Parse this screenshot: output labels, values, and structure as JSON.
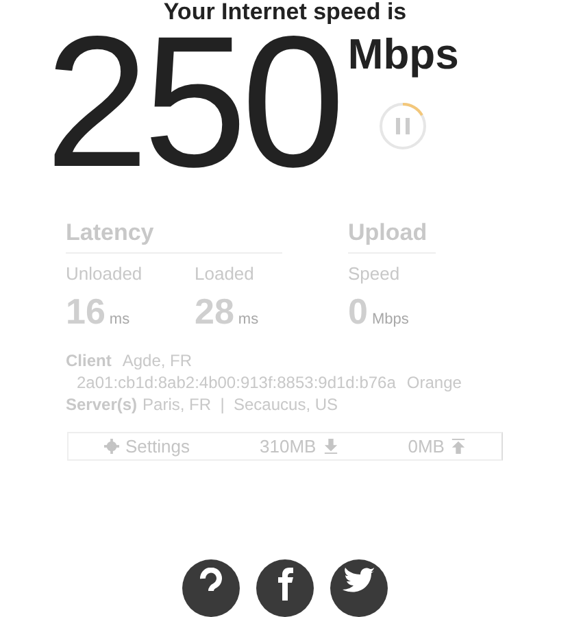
{
  "heading": "Your Internet speed is",
  "speed": {
    "value": "250",
    "unit": "Mbps"
  },
  "latency": {
    "title": "Latency",
    "metrics": [
      {
        "label": "Unloaded",
        "value": "16",
        "unit": "ms"
      },
      {
        "label": "Loaded",
        "value": "28",
        "unit": "ms"
      }
    ]
  },
  "upload": {
    "title": "Upload",
    "metrics": [
      {
        "label": "Speed",
        "value": "0",
        "unit": "Mbps"
      }
    ]
  },
  "client": {
    "label": "Client",
    "location": "Agde, FR",
    "address": "2a01:cb1d:8ab2:4b00:913f:8853:9d1d:b76a",
    "isp": "Orange"
  },
  "servers": {
    "label": "Server(s)",
    "list": "Paris, FR  |  Secaucus, US"
  },
  "toolbar": [
    {
      "kind": "settings",
      "label": "Settings"
    },
    {
      "kind": "download",
      "label": "310MB"
    },
    {
      "kind": "upload",
      "label": "0MB"
    }
  ],
  "social": [
    {
      "kind": "help"
    },
    {
      "kind": "facebook"
    },
    {
      "kind": "twitter"
    }
  ]
}
